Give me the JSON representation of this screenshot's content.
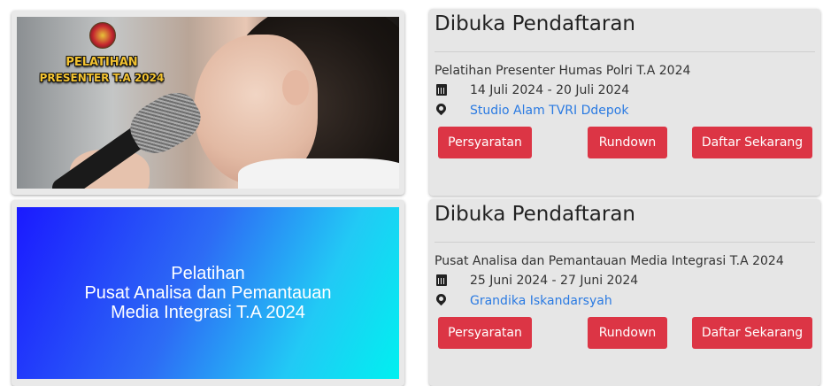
{
  "cards": [
    {
      "image": {
        "line1": "PELATIHAN",
        "line2": "PRESENTER T.A 2024"
      },
      "status": "Dibuka Pendaftaran",
      "event": "Pelatihan Presenter Humas Polri T.A 2024",
      "dates": "14 Juli 2024 - 20 Juli 2024",
      "location": "Studio Alam TVRI Ddepok",
      "buttons": {
        "requirements": "Persyaratan",
        "rundown": "Rundown",
        "register": "Daftar Sekarang"
      }
    },
    {
      "image": {
        "line1": "Pelatihan",
        "line2": "Pusat Analisa dan Pemantauan",
        "line3": "Media Integrasi T.A 2024"
      },
      "status": "Dibuka Pendaftaran",
      "event": "Pusat Analisa dan Pemantauan Media Integrasi T.A 2024",
      "dates": "25 Juni 2024 - 27 Juni 2024",
      "location": "Grandika Iskandarsyah",
      "buttons": {
        "requirements": "Persyaratan",
        "rundown": "Rundown",
        "register": "Daftar Sekarang"
      }
    }
  ],
  "icons": {
    "date": "calendar-icon",
    "location": "map-marker-icon"
  },
  "colors": {
    "button": "#dc3545",
    "link": "#2a7ae2",
    "card": "#e6e6e6"
  }
}
